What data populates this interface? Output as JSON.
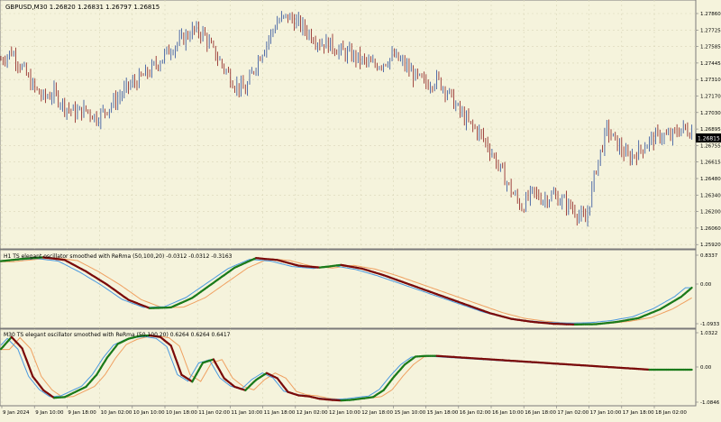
{
  "colors": {
    "background": "#f5f3dc",
    "grid": "#d9d6b8",
    "frame": "#7a7a7a",
    "separator": "#c8c8c8",
    "bull": "#2a4d9c",
    "bear": "#8b1a1a",
    "osc_up": "#1a7a1a",
    "osc_down": "#7a0a0a",
    "osc_fast": "#4a9ae0",
    "osc_slow": "#f0a060",
    "price_box": "#000000",
    "price_text": "#ffffff",
    "text": "#000000"
  },
  "main": {
    "legend": "GBPUSD,M30  1.26820 1.26831 1.26797 1.26815",
    "current_price": "1.26815",
    "price_labels": [
      "1.27860",
      "1.27725",
      "1.27585",
      "1.27445",
      "1.27310",
      "1.27170",
      "1.27030",
      "1.26895",
      "1.26755",
      "1.26615",
      "1.26480",
      "1.26340",
      "1.26200",
      "1.26060",
      "1.25920"
    ],
    "range": [
      1.2585,
      1.2795
    ]
  },
  "panel1": {
    "legend": "H1 TS elegant oscillator smoothed with ReRma (50,100,20) -0.0312 -0.0312 -0.3163",
    "labels": [
      "0.8337",
      "0.00",
      "-1.0933"
    ]
  },
  "panel2": {
    "legend": "M30 TS elegant oscillator smoothed with ReRma (50,100,20) 0.6264 0.6264 0.6417",
    "labels": [
      "1.0322",
      "0.00",
      "-1.0846"
    ]
  },
  "time_labels": [
    "9 Jan 2024",
    "9 Jan 10:00",
    "9 Jan 18:00",
    "10 Jan 02:00",
    "10 Jan 10:00",
    "10 Jan 18:00",
    "11 Jan 02:00",
    "11 Jan 10:00",
    "11 Jan 18:00",
    "12 Jan 02:00",
    "12 Jan 10:00",
    "12 Jan 18:00",
    "15 Jan 10:00",
    "15 Jan 18:00",
    "16 Jan 02:00",
    "16 Jan 10:00",
    "16 Jan 18:00",
    "17 Jan 02:00",
    "17 Jan 10:00",
    "17 Jan 18:00",
    "18 Jan 02:00"
  ],
  "price_path": [
    [
      0,
      1.2745
    ],
    [
      5,
      1.2752
    ],
    [
      10,
      1.2738
    ],
    [
      15,
      1.2722
    ],
    [
      20,
      1.2712
    ],
    [
      25,
      1.2716
    ],
    [
      30,
      1.2705
    ],
    [
      35,
      1.2699
    ],
    [
      40,
      1.2702
    ],
    [
      45,
      1.2695
    ],
    [
      50,
      1.2703
    ],
    [
      55,
      1.2712
    ],
    [
      60,
      1.2722
    ],
    [
      65,
      1.2728
    ],
    [
      70,
      1.2735
    ],
    [
      75,
      1.2745
    ],
    [
      80,
      1.2755
    ],
    [
      85,
      1.2762
    ],
    [
      90,
      1.277
    ],
    [
      95,
      1.2768
    ],
    [
      100,
      1.2752
    ],
    [
      105,
      1.2738
    ],
    [
      110,
      1.2724
    ],
    [
      115,
      1.2718
    ],
    [
      120,
      1.2742
    ],
    [
      125,
      1.276
    ],
    [
      130,
      1.2778
    ],
    [
      135,
      1.2782
    ],
    [
      140,
      1.2776
    ],
    [
      145,
      1.2768
    ],
    [
      150,
      1.276
    ],
    [
      155,
      1.2758
    ],
    [
      160,
      1.2752
    ],
    [
      165,
      1.2749
    ],
    [
      170,
      1.2744
    ],
    [
      175,
      1.274
    ],
    [
      180,
      1.2743
    ],
    [
      185,
      1.2748
    ],
    [
      190,
      1.274
    ],
    [
      195,
      1.273
    ],
    [
      200,
      1.2724
    ],
    [
      205,
      1.2728
    ],
    [
      210,
      1.2718
    ],
    [
      215,
      1.2702
    ],
    [
      220,
      1.269
    ],
    [
      225,
      1.2682
    ],
    [
      230,
      1.2668
    ],
    [
      235,
      1.265
    ],
    [
      240,
      1.2632
    ],
    [
      245,
      1.2618
    ],
    [
      250,
      1.263
    ],
    [
      255,
      1.2625
    ],
    [
      260,
      1.2628
    ],
    [
      265,
      1.2622
    ],
    [
      270,
      1.2615
    ],
    [
      275,
      1.2605
    ],
    [
      280,
      1.2652
    ],
    [
      285,
      1.2685
    ],
    [
      290,
      1.2672
    ],
    [
      295,
      1.266
    ],
    [
      300,
      1.2666
    ],
    [
      305,
      1.2675
    ],
    [
      310,
      1.268
    ],
    [
      315,
      1.2678
    ],
    [
      320,
      1.2686
    ],
    [
      325,
      1.2683
    ]
  ],
  "osc1_path": [
    [
      0,
      0.72
    ],
    [
      10,
      0.78
    ],
    [
      20,
      0.82
    ],
    [
      30,
      0.75
    ],
    [
      40,
      0.45
    ],
    [
      50,
      0.1
    ],
    [
      60,
      -0.3
    ],
    [
      70,
      -0.52
    ],
    [
      80,
      -0.5
    ],
    [
      90,
      -0.25
    ],
    [
      100,
      0.15
    ],
    [
      110,
      0.55
    ],
    [
      120,
      0.8
    ],
    [
      130,
      0.75
    ],
    [
      140,
      0.6
    ],
    [
      150,
      0.55
    ],
    [
      160,
      0.62
    ],
    [
      170,
      0.52
    ],
    [
      180,
      0.35
    ],
    [
      190,
      0.15
    ],
    [
      200,
      -0.05
    ],
    [
      210,
      -0.25
    ],
    [
      220,
      -0.45
    ],
    [
      230,
      -0.65
    ],
    [
      240,
      -0.8
    ],
    [
      250,
      -0.88
    ],
    [
      260,
      -0.93
    ],
    [
      270,
      -0.95
    ],
    [
      280,
      -0.94
    ],
    [
      290,
      -0.88
    ],
    [
      300,
      -0.78
    ],
    [
      310,
      -0.55
    ],
    [
      320,
      -0.22
    ],
    [
      325,
      0.02
    ]
  ],
  "osc2_path": [
    [
      0,
      0.6
    ],
    [
      5,
      0.95
    ],
    [
      10,
      0.62
    ],
    [
      15,
      -0.2
    ],
    [
      20,
      -0.6
    ],
    [
      25,
      -0.82
    ],
    [
      30,
      -0.8
    ],
    [
      35,
      -0.65
    ],
    [
      40,
      -0.5
    ],
    [
      45,
      -0.15
    ],
    [
      50,
      0.35
    ],
    [
      55,
      0.75
    ],
    [
      60,
      0.9
    ],
    [
      65,
      0.98
    ],
    [
      70,
      1.0
    ],
    [
      75,
      0.95
    ],
    [
      80,
      0.7
    ],
    [
      85,
      -0.15
    ],
    [
      90,
      -0.35
    ],
    [
      95,
      0.2
    ],
    [
      100,
      0.3
    ],
    [
      105,
      -0.25
    ],
    [
      110,
      -0.5
    ],
    [
      115,
      -0.6
    ],
    [
      120,
      -0.3
    ],
    [
      125,
      -0.1
    ],
    [
      130,
      -0.25
    ],
    [
      135,
      -0.65
    ],
    [
      140,
      -0.75
    ],
    [
      145,
      -0.78
    ],
    [
      150,
      -0.85
    ],
    [
      155,
      -0.88
    ],
    [
      160,
      -0.9
    ],
    [
      165,
      -0.88
    ],
    [
      170,
      -0.84
    ],
    [
      175,
      -0.8
    ],
    [
      180,
      -0.6
    ],
    [
      185,
      -0.2
    ],
    [
      190,
      0.15
    ],
    [
      195,
      0.38
    ],
    [
      200,
      0.4
    ],
    [
      205,
      0.4
    ],
    [
      210,
      0.38
    ],
    [
      215,
      0.36
    ],
    [
      220,
      0.34
    ],
    [
      225,
      0.32
    ],
    [
      230,
      0.3
    ],
    [
      235,
      0.28
    ],
    [
      240,
      0.26
    ],
    [
      245,
      0.24
    ],
    [
      250,
      0.22
    ],
    [
      255,
      0.2
    ],
    [
      260,
      0.18
    ],
    [
      265,
      0.16
    ],
    [
      270,
      0.14
    ],
    [
      275,
      0.12
    ],
    [
      280,
      0.1
    ],
    [
      285,
      0.08
    ],
    [
      290,
      0.06
    ],
    [
      295,
      0.04
    ],
    [
      300,
      0.02
    ],
    [
      305,
      0.0
    ],
    [
      310,
      0.0
    ],
    [
      315,
      0.0
    ],
    [
      320,
      0.0
    ],
    [
      325,
      0.0
    ]
  ]
}
